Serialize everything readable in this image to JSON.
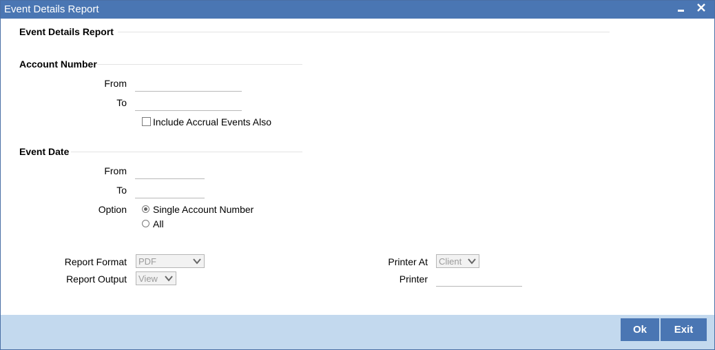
{
  "window": {
    "title": "Event Details Report"
  },
  "header": {
    "section_title": "Event Details Report"
  },
  "account_number": {
    "section_title": "Account Number",
    "from_label": "From",
    "from_value": "",
    "to_label": "To",
    "to_value": "",
    "include_accrual_label": "Include Accrual Events Also",
    "include_accrual_checked": false
  },
  "event_date": {
    "section_title": "Event Date",
    "from_label": "From",
    "from_value": "",
    "to_label": "To",
    "to_value": "",
    "option_label": "Option",
    "options": [
      {
        "label": "Single Account Number",
        "selected": true
      },
      {
        "label": "All",
        "selected": false
      }
    ]
  },
  "report": {
    "format_label": "Report Format",
    "format_value": "PDF",
    "output_label": "Report Output",
    "output_value": "View",
    "printer_at_label": "Printer At",
    "printer_at_value": "Client",
    "printer_label": "Printer",
    "printer_value": ""
  },
  "footer": {
    "ok_label": "Ok",
    "exit_label": "Exit"
  },
  "colors": {
    "titlebar": "#4a76b3",
    "footer_band": "#c3d9ee",
    "button": "#4a76b3"
  }
}
